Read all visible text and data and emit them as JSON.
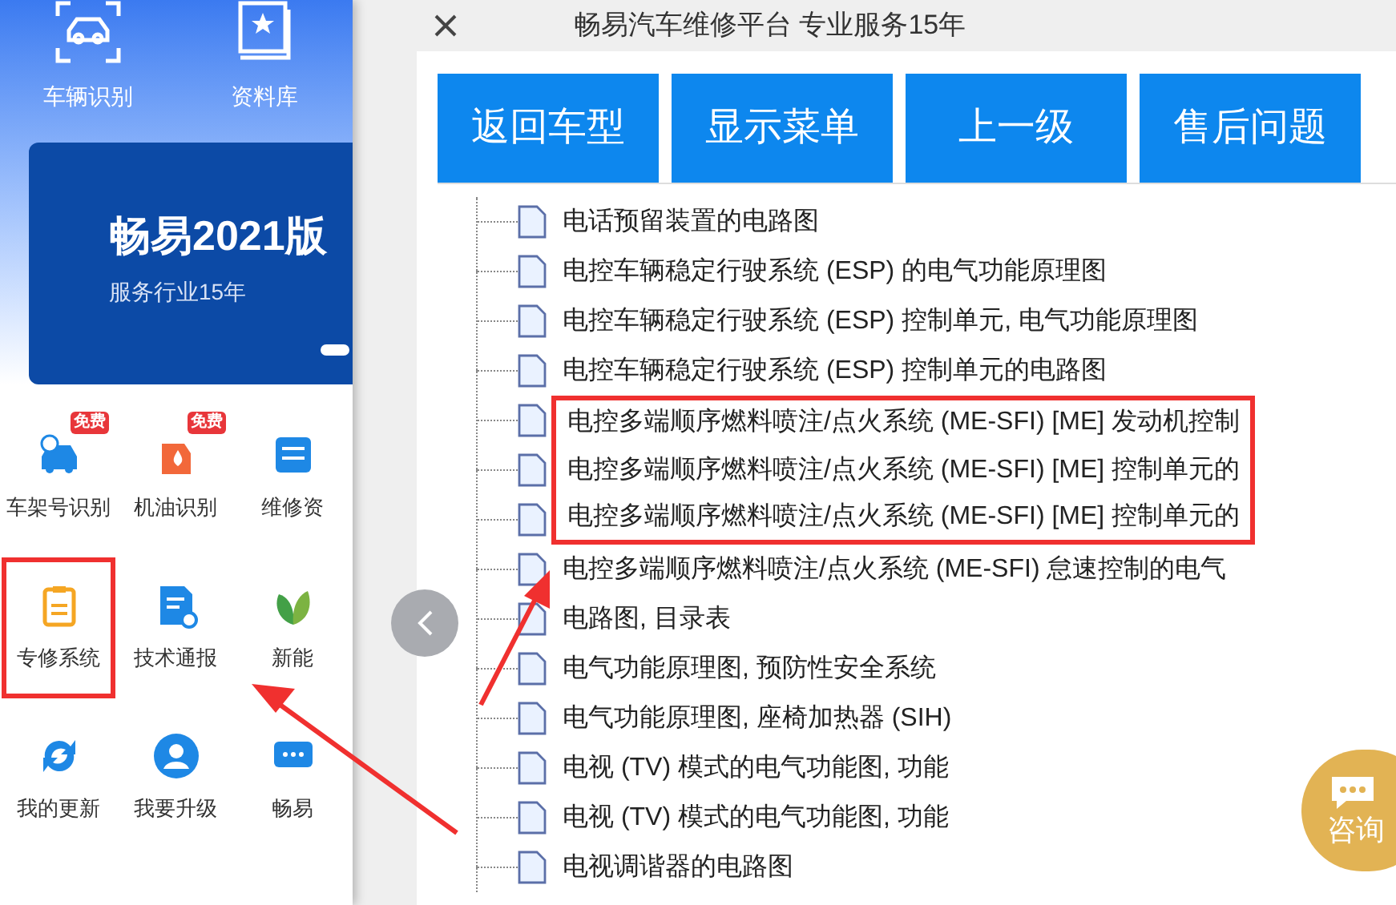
{
  "sidebar": {
    "top_items": [
      {
        "label": "车辆识别",
        "kind": "car"
      },
      {
        "label": "资料库",
        "kind": "book"
      }
    ],
    "banner": {
      "title": "畅易2021版",
      "subtitle": "服务行业15年"
    },
    "grid": [
      {
        "label": "车架号识别",
        "kind": "vin",
        "badge": "免费",
        "highlighted": false
      },
      {
        "label": "机油识别",
        "kind": "oil",
        "badge": "免费",
        "highlighted": false
      },
      {
        "label": "维修资",
        "kind": "doc",
        "highlighted": false
      },
      {
        "label": "专修系统",
        "kind": "clipboard",
        "highlighted": true
      },
      {
        "label": "技术通报",
        "kind": "report",
        "highlighted": false
      },
      {
        "label": "新能",
        "kind": "leaf",
        "highlighted": false
      },
      {
        "label": "我的更新",
        "kind": "refresh",
        "highlighted": false
      },
      {
        "label": "我要升级",
        "kind": "user",
        "highlighted": false
      },
      {
        "label": "畅易",
        "kind": "chat",
        "highlighted": false
      }
    ]
  },
  "window": {
    "title": "畅易汽车维修平台 专业服务15年"
  },
  "buttons": [
    "返回车型",
    "显示菜单",
    "上一级",
    "售后问题"
  ],
  "tree": [
    {
      "label": "电话预留装置的电路图",
      "highlighted": false
    },
    {
      "label": "电控车辆稳定行驶系统 (ESP) 的电气功能原理图",
      "highlighted": false
    },
    {
      "label": "电控车辆稳定行驶系统 (ESP) 控制单元, 电气功能原理图",
      "highlighted": false
    },
    {
      "label": "电控车辆稳定行驶系统 (ESP) 控制单元的电路图",
      "highlighted": false
    },
    {
      "label": "电控多端顺序燃料喷注/点火系统 (ME-SFI) [ME] 发动机控制",
      "highlighted": true
    },
    {
      "label": "电控多端顺序燃料喷注/点火系统 (ME-SFI) [ME] 控制单元的",
      "highlighted": true
    },
    {
      "label": "电控多端顺序燃料喷注/点火系统 (ME-SFI) [ME] 控制单元的",
      "highlighted": true
    },
    {
      "label": "电控多端顺序燃料喷注/点火系统 (ME-SFI) 怠速控制的电气",
      "highlighted": false
    },
    {
      "label": "电路图, 目录表",
      "highlighted": false
    },
    {
      "label": "电气功能原理图, 预防性安全系统",
      "highlighted": false
    },
    {
      "label": "电气功能原理图, 座椅加热器 (SIH)",
      "highlighted": false
    },
    {
      "label": "电视 (TV) 模式的电气功能图, 功能",
      "highlighted": false
    },
    {
      "label": "电视 (TV) 模式的电气功能图, 功能",
      "highlighted": false
    },
    {
      "label": "电视调谐器的电路图",
      "highlighted": false
    }
  ],
  "consult": {
    "label": "咨询"
  }
}
